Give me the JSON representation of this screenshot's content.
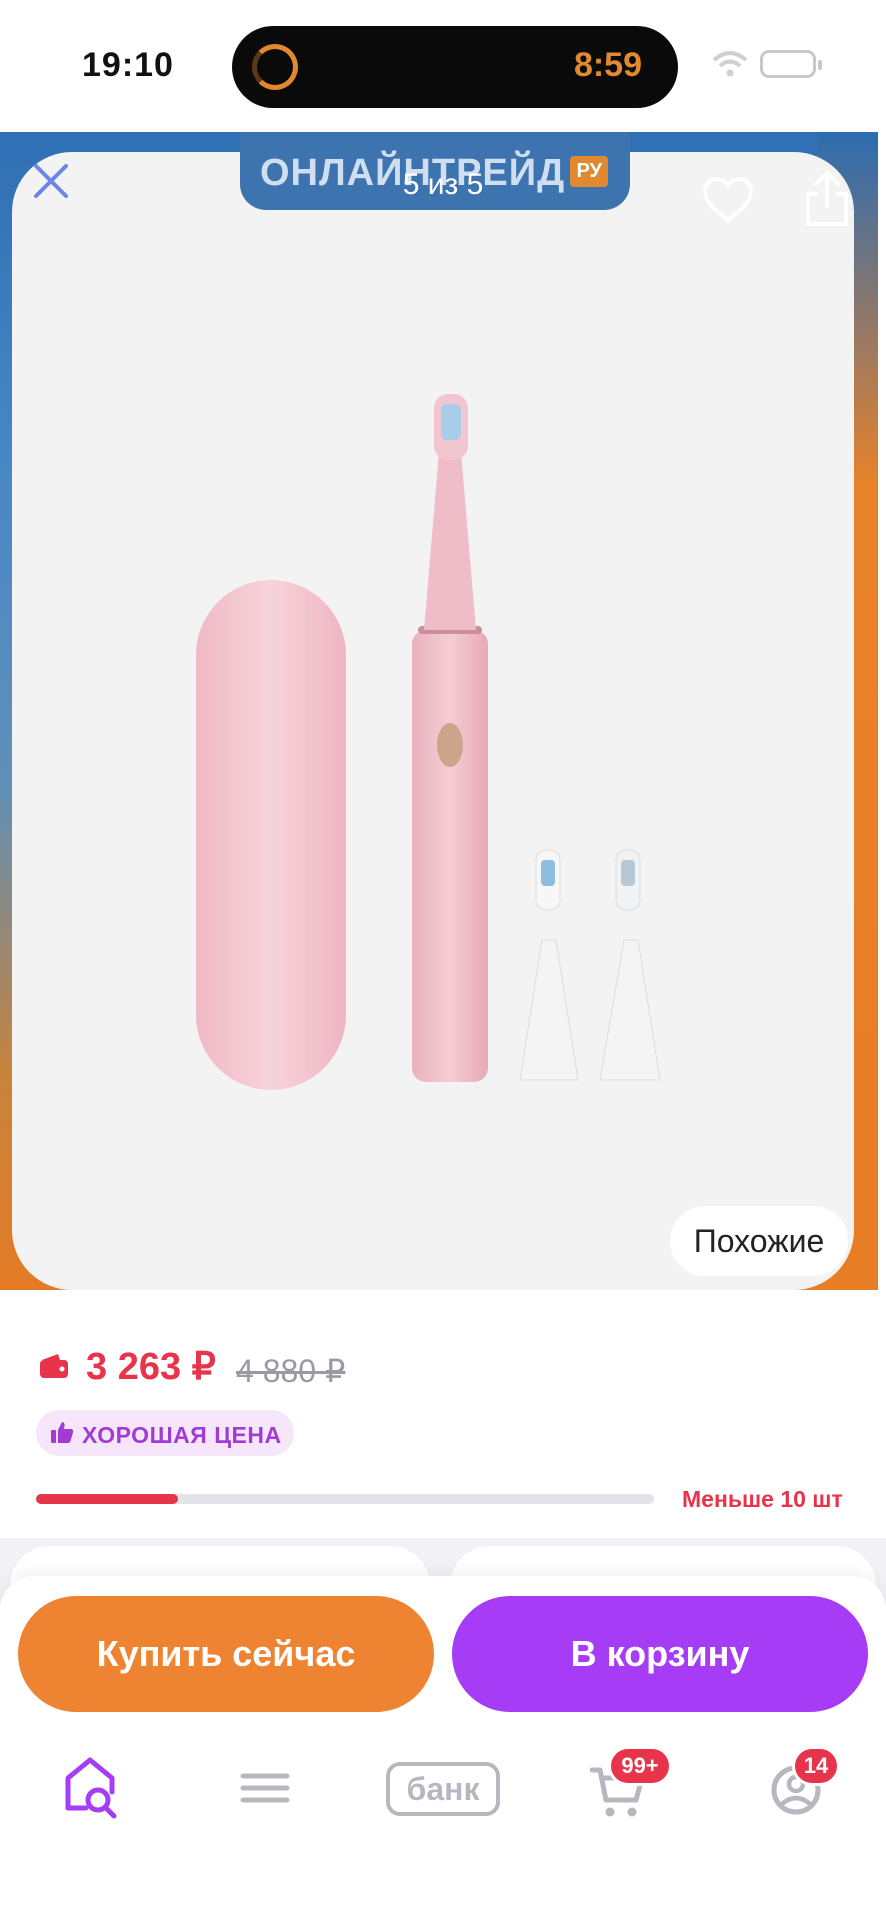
{
  "status_bar": {
    "time": "19:10",
    "island_time": "8:59"
  },
  "gallery": {
    "brand_text": "ОНЛАЙНТРЕЙД",
    "brand_suffix": "РУ",
    "counter": "5 из 5",
    "similar_label": "Похожие"
  },
  "price": {
    "current": "3 263 ₽",
    "old": "4 880 ₽",
    "badge": "ХОРОШАЯ ЦЕНА",
    "stock_text": "Меньше 10 шт",
    "stock_fraction": 0.23
  },
  "actions": {
    "buy_now": "Купить сейчас",
    "add_to_cart": "В корзину"
  },
  "tabbar": {
    "bank_label": "банк",
    "cart_badge": "99+",
    "profile_badge": "14"
  },
  "colors": {
    "price_red": "#e8344a",
    "brand_purple": "#a63cf5",
    "buy_orange": "#ee8431"
  }
}
